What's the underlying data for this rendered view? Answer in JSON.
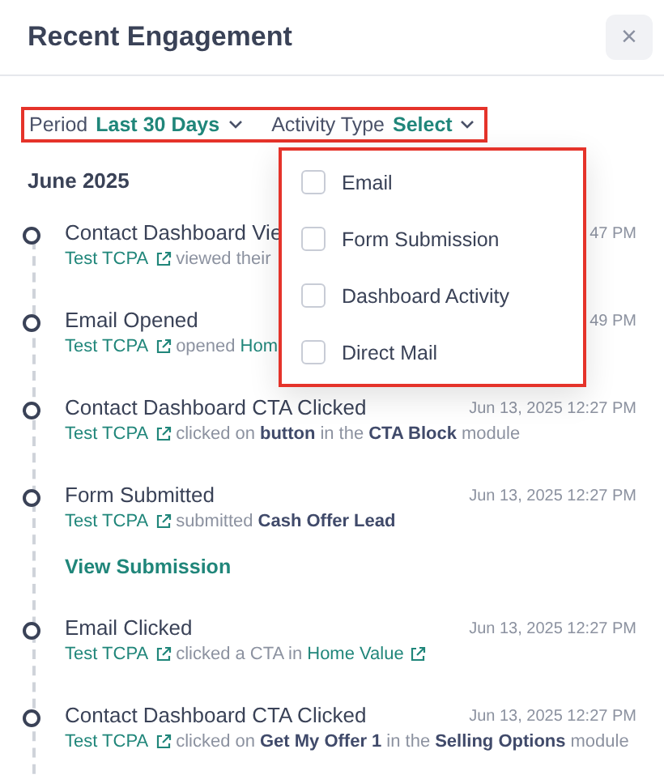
{
  "panel": {
    "title": "Recent Engagement",
    "close_icon": "×"
  },
  "filters": {
    "highlighted": true,
    "items": [
      {
        "label": "Period",
        "value": "Last 30 Days"
      },
      {
        "label": "Activity Type",
        "value": "Select"
      }
    ]
  },
  "dropdown": {
    "highlighted": true,
    "options": [
      {
        "label": "Email",
        "checked": false
      },
      {
        "label": "Form Submission",
        "checked": false
      },
      {
        "label": "Dashboard Activity",
        "checked": false
      },
      {
        "label": "Direct Mail",
        "checked": false
      }
    ]
  },
  "month": "June 2025",
  "events": [
    {
      "title": "Contact Dashboard Vie",
      "time": "47 PM",
      "parts": [
        {
          "kind": "contact",
          "text": "Test TCPA"
        },
        {
          "kind": "text",
          "text": "viewed their"
        }
      ]
    },
    {
      "title": "Email Opened",
      "time": "49 PM",
      "parts": [
        {
          "kind": "contact",
          "text": "Test TCPA"
        },
        {
          "kind": "text",
          "text": "opened"
        },
        {
          "kind": "plain_link",
          "text": "Hom"
        }
      ]
    },
    {
      "title": "Contact Dashboard CTA Clicked",
      "time": "Jun 13, 2025 12:27 PM",
      "parts": [
        {
          "kind": "contact",
          "text": "Test TCPA"
        },
        {
          "kind": "text",
          "text": "clicked on"
        },
        {
          "kind": "strong",
          "text": "button"
        },
        {
          "kind": "text",
          "text": "in the"
        },
        {
          "kind": "strong",
          "text": "CTA Block"
        },
        {
          "kind": "text",
          "text": "module"
        }
      ]
    },
    {
      "title": "Form Submitted",
      "time": "Jun 13, 2025 12:27 PM",
      "action": "View Submission",
      "parts": [
        {
          "kind": "contact",
          "text": "Test TCPA"
        },
        {
          "kind": "text",
          "text": "submitted"
        },
        {
          "kind": "strong",
          "text": "Cash Offer Lead"
        }
      ]
    },
    {
      "title": "Email Clicked",
      "time": "Jun 13, 2025 12:27 PM",
      "parts": [
        {
          "kind": "contact",
          "text": "Test TCPA"
        },
        {
          "kind": "text",
          "text": "clicked a CTA in"
        },
        {
          "kind": "contact",
          "text": "Home Value"
        }
      ]
    },
    {
      "title": "Contact Dashboard CTA Clicked",
      "time": "Jun 13, 2025 12:27 PM",
      "parts": [
        {
          "kind": "contact",
          "text": "Test TCPA"
        },
        {
          "kind": "text",
          "text": "clicked on"
        },
        {
          "kind": "strong",
          "text": "Get My Offer 1"
        },
        {
          "kind": "text",
          "text": "in the"
        },
        {
          "kind": "strong",
          "text": "Selling Options"
        },
        {
          "kind": "text",
          "text": "module"
        }
      ]
    }
  ]
}
